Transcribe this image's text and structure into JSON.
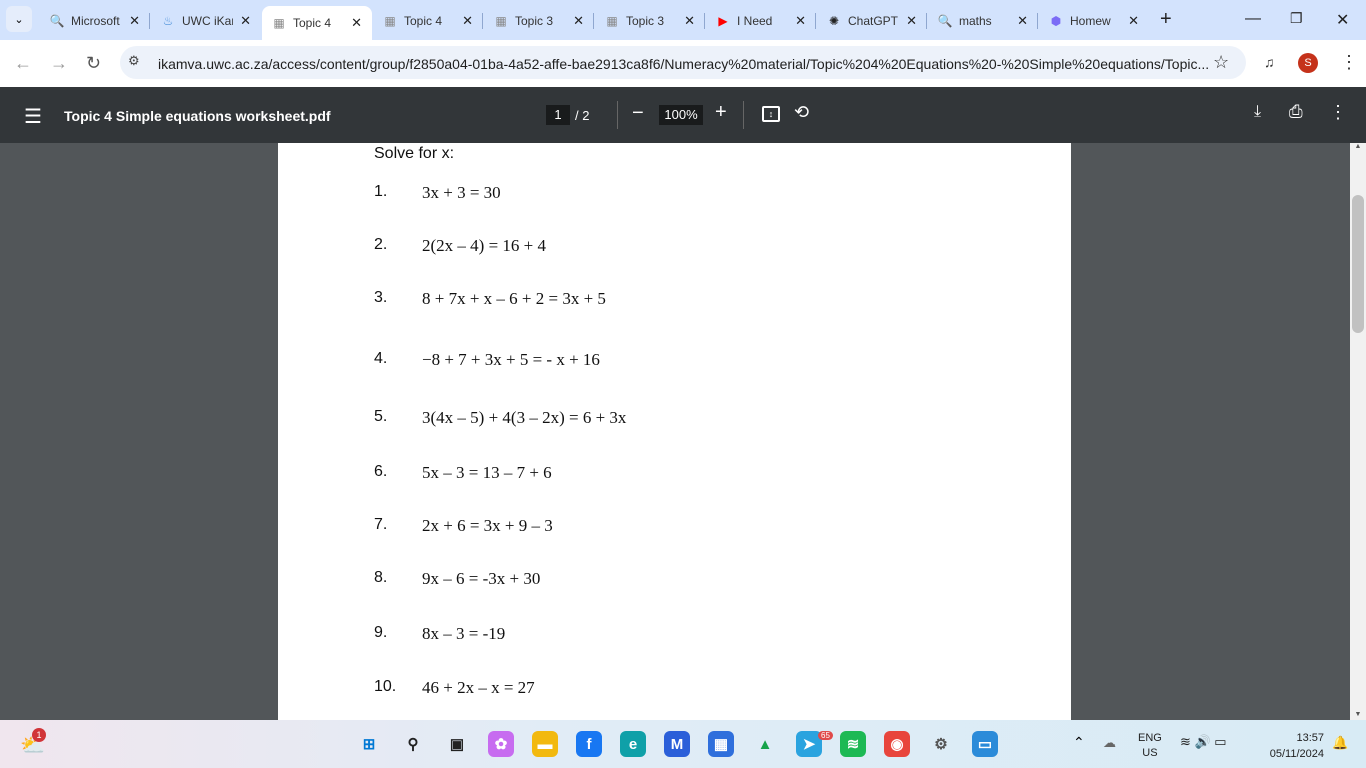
{
  "tabs": [
    {
      "title": "Microsoft",
      "icon": "search-icon"
    },
    {
      "title": "UWC iKamva",
      "icon": "uwc-icon"
    },
    {
      "title": "Topic 4",
      "icon": "pdf-icon",
      "active": true
    },
    {
      "title": "Topic 4",
      "icon": "pdf-icon"
    },
    {
      "title": "Topic 3",
      "icon": "pdf-icon"
    },
    {
      "title": "Topic 3",
      "icon": "pdf-icon"
    },
    {
      "title": "I Need",
      "icon": "youtube-icon"
    },
    {
      "title": "ChatGPT",
      "icon": "chatgpt-icon"
    },
    {
      "title": "maths",
      "icon": "search-icon"
    },
    {
      "title": "Homew",
      "icon": "app-icon"
    }
  ],
  "address": {
    "url": "ikamva.uwc.ac.za/access/content/group/f2850a04-01ba-4a52-affe-bae2913ca8f6/Numeracy%20material/Topic%204%20Equations%20-%20Simple%20equations/Topic...",
    "profile": "S"
  },
  "pdf": {
    "title": "Topic 4 Simple equations worksheet.pdf",
    "page": "1",
    "total": "/  2",
    "zoom": "100%"
  },
  "worksheet": {
    "heading": "Solve for x:",
    "equations": [
      {
        "n": "1.",
        "e": "3x + 3 = 30"
      },
      {
        "n": "2.",
        "e": "2(2x – 4) = 16 + 4"
      },
      {
        "n": "3.",
        "e": "8 + 7x + x – 6 + 2 = 3x + 5"
      },
      {
        "n": "4.",
        "e": "−8 + 7 + 3x + 5 = - x + 16"
      },
      {
        "n": "5.",
        "e": "3(4x – 5) + 4(3 – 2x) = 6 + 3x"
      },
      {
        "n": "6.",
        "e": "5x – 3 = 13 – 7 + 6"
      },
      {
        "n": "7.",
        "e": "2x + 6 = 3x + 9 – 3"
      },
      {
        "n": "8.",
        "e": "9x – 6 = -3x + 30"
      },
      {
        "n": "9.",
        "e": "8x – 3 = -19"
      },
      {
        "n": "10.",
        "e": "46 + 2x – x = 27"
      }
    ]
  },
  "taskbar": {
    "weather_badge": "1",
    "telegram_badge": "65",
    "lang": "ENG",
    "region": "US",
    "time": "13:57",
    "date": "05/11/2024"
  }
}
